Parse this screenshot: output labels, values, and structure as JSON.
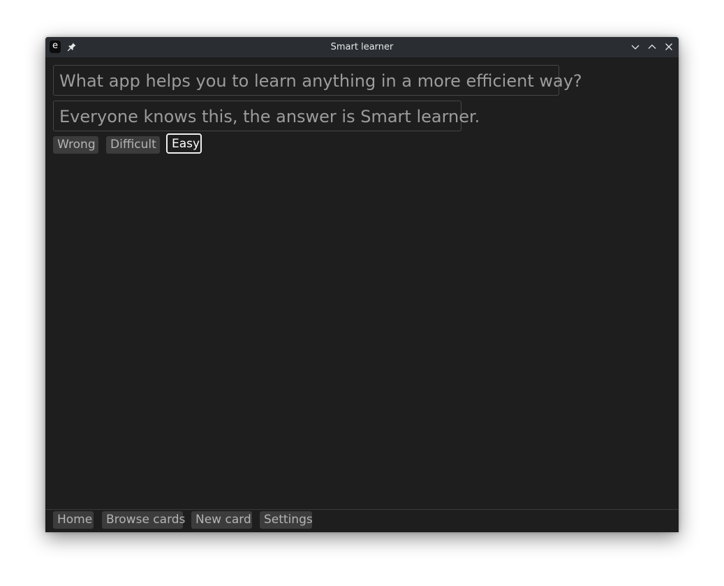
{
  "window": {
    "title": "Smart learner",
    "app_icon_letter": "e"
  },
  "card": {
    "question": "What app helps you to learn anything in a more efficient way?",
    "answer": "Everyone knows this, the answer is Smart learner."
  },
  "rating": {
    "wrong_label": "Wrong",
    "difficult_label": "Difficult",
    "easy_label": "Easy"
  },
  "nav": {
    "home_label": "Home",
    "browse_label": "Browse cards",
    "new_card_label": "New card",
    "settings_label": "Settings"
  },
  "colors": {
    "background": "#1e1e1e",
    "titlebar": "#2a2e32",
    "button": "#3c3c3c",
    "focused_border": "#f0f0f0"
  },
  "icons": {
    "app": "app-e-icon",
    "pin": "pin-icon",
    "minimize": "chevron-down-icon",
    "maximize": "chevron-up-icon",
    "close": "close-icon"
  }
}
